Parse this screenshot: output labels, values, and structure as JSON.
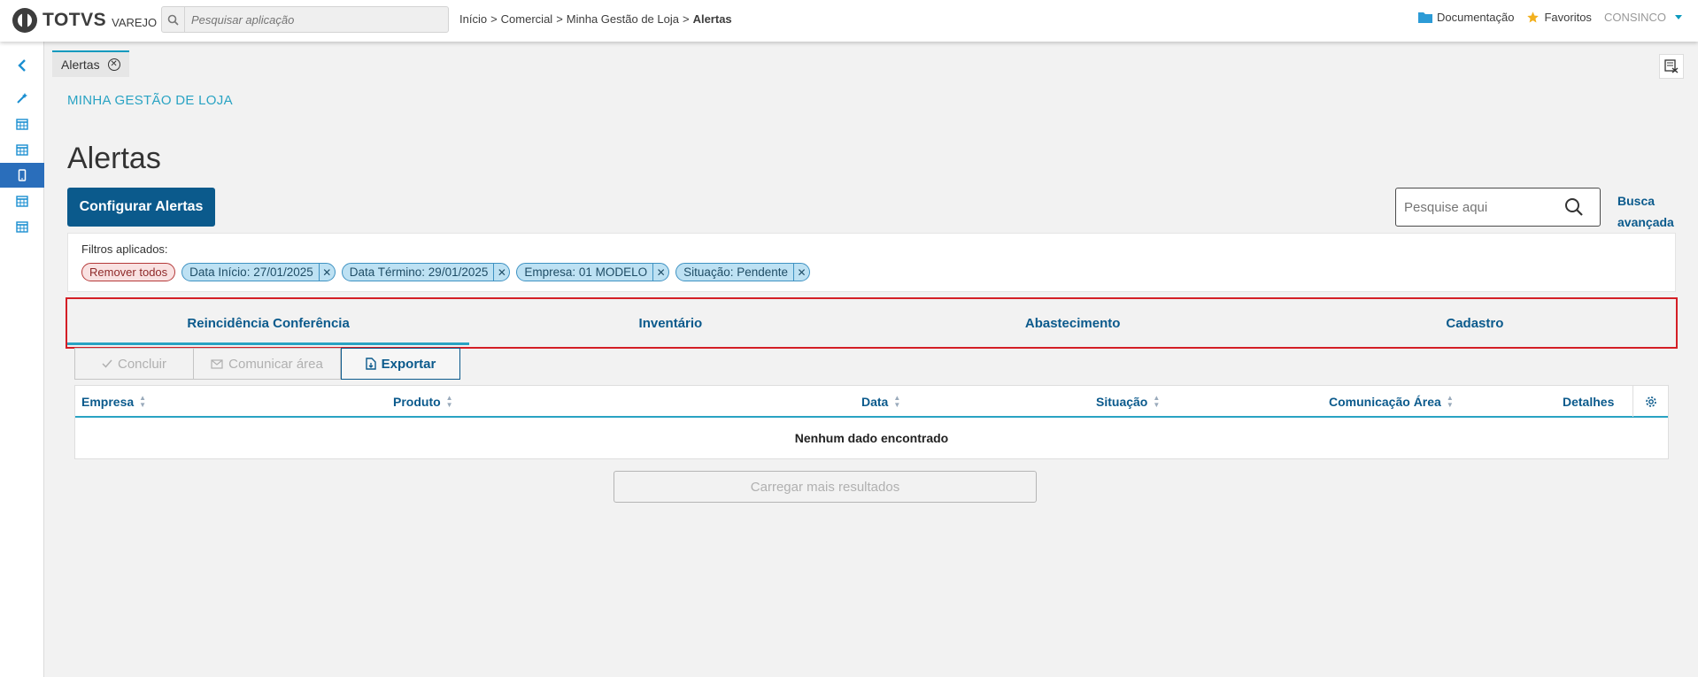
{
  "header": {
    "brand": "TOTVS",
    "brand_sub": "VAREJO",
    "search_placeholder": "Pesquisar aplicação",
    "breadcrumb": [
      "Início",
      "Comercial",
      "Minha Gestão de Loja",
      "Alertas"
    ],
    "breadcrumb_sep": ">",
    "docs_label": "Documentação",
    "favorites_label": "Favoritos",
    "user_label": "CONSINCO",
    "colors": {
      "accent": "#0c9abe",
      "folder": "#2c9bd6",
      "star": "#f2b01e"
    }
  },
  "sidebar": {
    "items": [
      {
        "icon": "chevron-left-icon"
      },
      {
        "icon": "wand-icon"
      },
      {
        "icon": "table-icon"
      },
      {
        "icon": "table-icon"
      },
      {
        "icon": "mobile-icon",
        "active": true
      },
      {
        "icon": "table-icon"
      },
      {
        "icon": "table-icon"
      }
    ]
  },
  "page_tabs": [
    {
      "label": "Alertas"
    }
  ],
  "module": "MINHA GESTÃO DE LOJA",
  "title": "Alertas",
  "configure_button": "Configurar Alertas",
  "search": {
    "placeholder": "Pesquise aqui",
    "advanced_label_1": "Busca",
    "advanced_label_2": "avançada"
  },
  "filters": {
    "label": "Filtros aplicados:",
    "remove_all": "Remover todos",
    "chips": [
      "Data Início: 27/01/2025",
      "Data Término: 29/01/2025",
      "Empresa: 01 MODELO",
      "Situação: Pendente"
    ]
  },
  "tabs": [
    {
      "label": "Reincidência Conferência",
      "active": true
    },
    {
      "label": "Inventário"
    },
    {
      "label": "Abastecimento"
    },
    {
      "label": "Cadastro"
    }
  ],
  "actions": [
    {
      "label": "Concluir",
      "icon": "check-icon",
      "enabled": false
    },
    {
      "label": "Comunicar área",
      "icon": "mail-icon",
      "enabled": false
    },
    {
      "label": "Exportar",
      "icon": "file-export-icon",
      "enabled": true
    }
  ],
  "grid": {
    "columns": [
      "Empresa",
      "Produto",
      "Data",
      "Situação",
      "Comunicação Área",
      "Detalhes"
    ],
    "empty_text": "Nenhum dado encontrado"
  },
  "load_more": "Carregar mais resultados"
}
